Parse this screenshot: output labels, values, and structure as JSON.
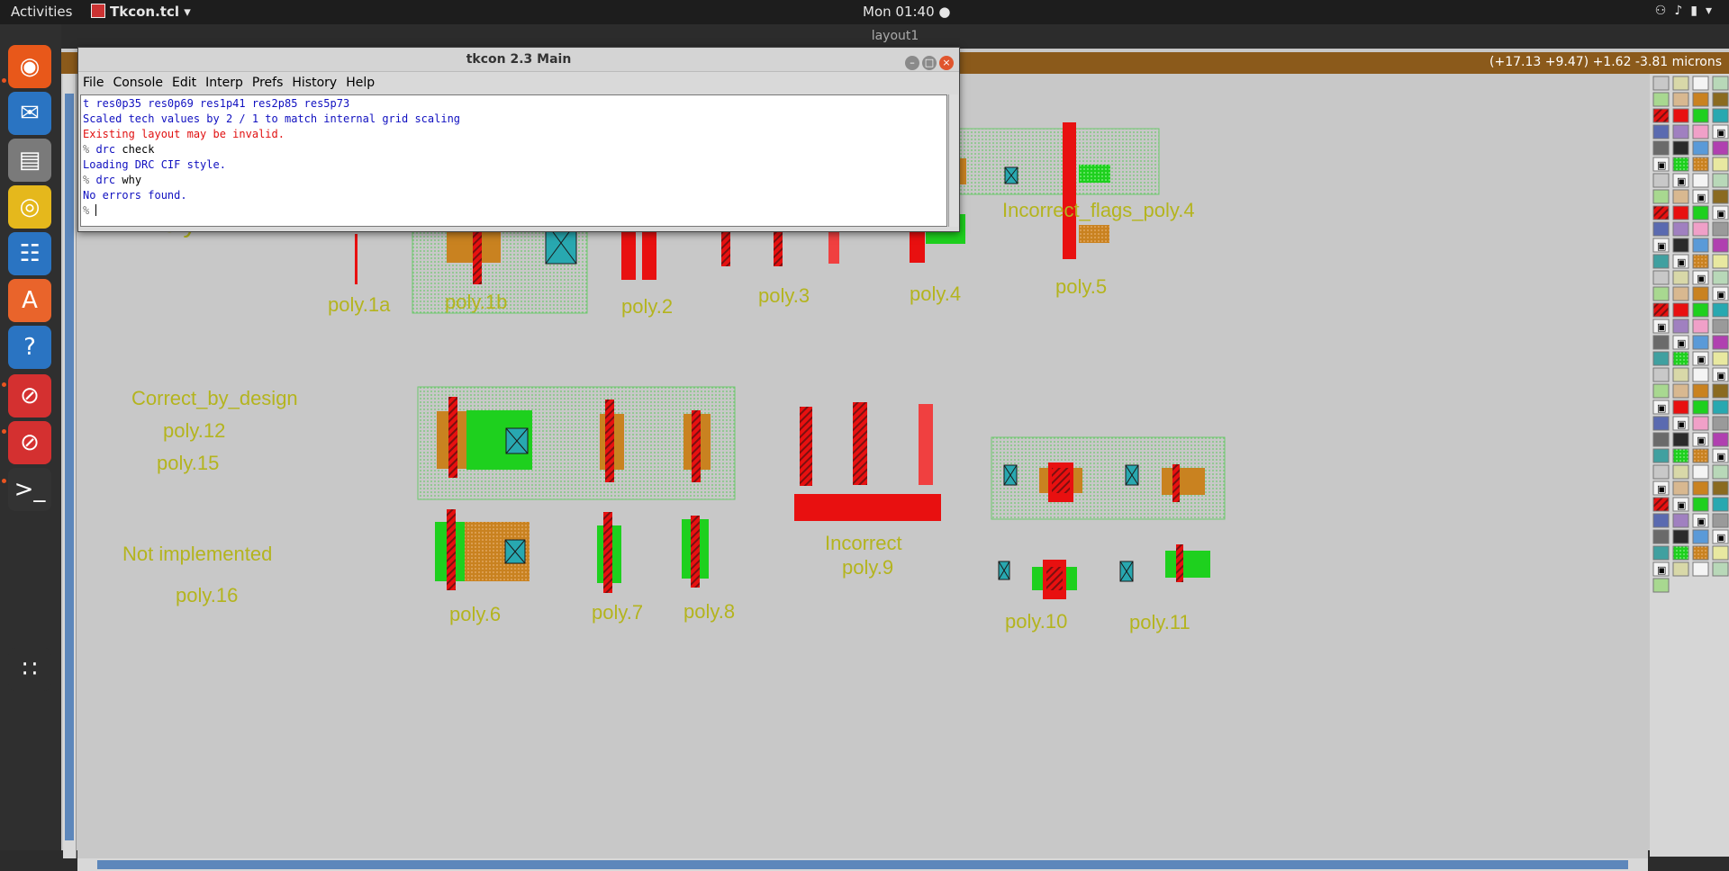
{
  "topbar": {
    "activities": "Activities",
    "app_name": "Tkcon.tcl",
    "clock": "Mon 01:40"
  },
  "dock": {
    "items": [
      {
        "name": "firefox-icon",
        "glyph": "◉",
        "color": "#e8581a"
      },
      {
        "name": "thunderbird-icon",
        "glyph": "✉",
        "color": "#2a74c2"
      },
      {
        "name": "files-icon",
        "glyph": "▤",
        "color": "#7a7a7a"
      },
      {
        "name": "rhythmbox-icon",
        "glyph": "◎",
        "color": "#e5b81c"
      },
      {
        "name": "libreoffice-writer-icon",
        "glyph": "☷",
        "color": "#2a74c2"
      },
      {
        "name": "software-center-icon",
        "glyph": "A",
        "color": "#e9642b"
      },
      {
        "name": "help-icon",
        "glyph": "?",
        "color": "#2a74c2"
      },
      {
        "name": "magic-app-icon",
        "glyph": "⊘",
        "color": "#d43030"
      },
      {
        "name": "magic-app-2-icon",
        "glyph": "⊘",
        "color": "#d43030"
      },
      {
        "name": "terminal-icon",
        "glyph": ">_",
        "color": "#333333"
      },
      {
        "name": "show-apps-icon",
        "glyph": "∷",
        "color": "#2f2f2f"
      }
    ]
  },
  "magic": {
    "window_title": "layout1",
    "coords": "(+17.13 +9.47) +1.62 -3.81 microns",
    "labels": [
      {
        "id": "poly",
        "text": "Poly"
      },
      {
        "id": "poly1a",
        "text": "poly.1a"
      },
      {
        "id": "poly1b",
        "text": "poly.1b"
      },
      {
        "id": "poly2",
        "text": "poly.2"
      },
      {
        "id": "poly3",
        "text": "poly.3"
      },
      {
        "id": "poly4",
        "text": "poly.4"
      },
      {
        "id": "poly5",
        "text": "poly.5"
      },
      {
        "id": "incorrect-flags",
        "text": "Incorrect_flags_poly.4"
      },
      {
        "id": "correct-by-design",
        "text": "Correct_by_design"
      },
      {
        "id": "poly12",
        "text": "poly.12"
      },
      {
        "id": "poly15",
        "text": "poly.15"
      },
      {
        "id": "not-implemented",
        "text": "Not implemented"
      },
      {
        "id": "poly16",
        "text": "poly.16"
      },
      {
        "id": "poly6",
        "text": "poly.6"
      },
      {
        "id": "poly7",
        "text": "poly.7"
      },
      {
        "id": "poly8",
        "text": "poly.8"
      },
      {
        "id": "incorrect",
        "text": "Incorrect"
      },
      {
        "id": "poly9",
        "text": "poly.9"
      },
      {
        "id": "poly10",
        "text": "poly.10"
      },
      {
        "id": "poly11",
        "text": "poly.11"
      }
    ]
  },
  "tkcon": {
    "title": "tkcon 2.3 Main",
    "menu": [
      "File",
      "Console",
      "Edit",
      "Interp",
      "Prefs",
      "History",
      "Help"
    ],
    "lines": [
      {
        "prompt": "",
        "cmd": "",
        "text": "t res0p35 res0p69 res1p41 res2p85 res5p73",
        "kind": "out"
      },
      {
        "prompt": "",
        "cmd": "",
        "text": "Scaled tech values by 2 / 1 to match internal grid scaling",
        "kind": "out"
      },
      {
        "prompt": "",
        "cmd": "",
        "text": "Existing layout may be invalid.",
        "kind": "err"
      },
      {
        "prompt": "% ",
        "cmd": "drc",
        "text": " check",
        "kind": "cmd"
      },
      {
        "prompt": "",
        "cmd": "",
        "text": "Loading DRC CIF style.",
        "kind": "out"
      },
      {
        "prompt": "% ",
        "cmd": "drc",
        "text": " why",
        "kind": "cmd"
      },
      {
        "prompt": "",
        "cmd": "",
        "text": "No errors found.",
        "kind": "out"
      },
      {
        "prompt": "% ",
        "cmd": "",
        "text": "",
        "kind": "cmd"
      }
    ]
  },
  "colors": {
    "poly": "#e81010",
    "diff": "#c98220",
    "nwell": "#a8d890",
    "green": "#1ed01e",
    "contact": "#28a8b0",
    "label": "#b4b41e"
  }
}
